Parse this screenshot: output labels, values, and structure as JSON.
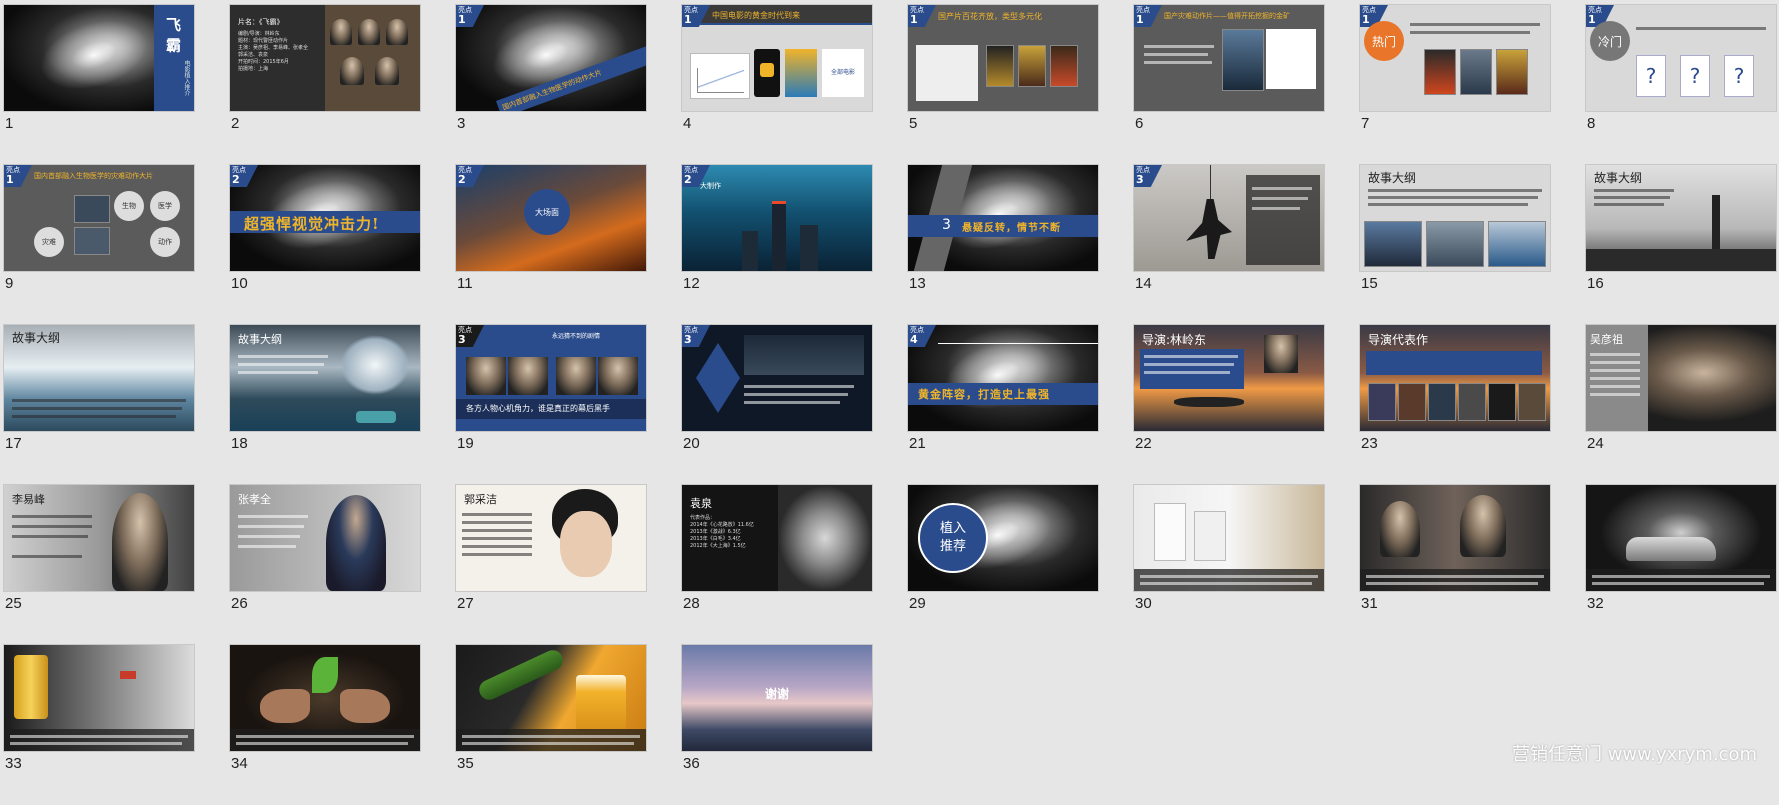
{
  "slides": [
    {
      "num": "1",
      "title": "飞  霸",
      "subtitle": "电影植入推介"
    },
    {
      "num": "2",
      "title": "片名：《飞霸》",
      "info": "编剧/导演：林岭东\n题材：现代警匪动作片\n主演：吴彦祖、李易峰、张孝全\n郭采洁、袁泉\n开拍时间：2015年6月\n拍摄地：上海"
    },
    {
      "num": "3",
      "badge": "亮点",
      "badge_num": "1",
      "slogan": "国内首部融入生物医学的动作大片"
    },
    {
      "num": "4",
      "badge": "亮点",
      "badge_num": "1",
      "title": "中国电影的黄金时代到来",
      "label": "全部电影"
    },
    {
      "num": "5",
      "badge": "亮点",
      "badge_num": "1",
      "title": "国产片百花齐放，类型多元化"
    },
    {
      "num": "6",
      "badge": "亮点",
      "badge_num": "1",
      "title": "国产灾难动作片——值得开拓挖掘的金矿"
    },
    {
      "num": "7",
      "badge": "亮点",
      "badge_num": "1",
      "tag": "热门"
    },
    {
      "num": "8",
      "badge": "亮点",
      "badge_num": "1",
      "tag": "冷门",
      "q": "?"
    },
    {
      "num": "9",
      "badge": "亮点",
      "badge_num": "1",
      "title": "国内首部融入生物医学的灾难动作大片",
      "c1": "生物",
      "c2": "医学",
      "c3": "灾难",
      "c4": "动作"
    },
    {
      "num": "10",
      "badge": "亮点",
      "badge_num": "2",
      "slogan": "超强悍视觉冲击力!"
    },
    {
      "num": "11",
      "badge": "亮点",
      "badge_num": "2",
      "label": "大场面"
    },
    {
      "num": "12",
      "badge": "亮点",
      "badge_num": "2",
      "label": "大制作"
    },
    {
      "num": "13",
      "badge_num": "3",
      "slogan": "悬疑反转，情节不断"
    },
    {
      "num": "14",
      "badge": "亮点",
      "badge_num": "3"
    },
    {
      "num": "15",
      "title": "故事大纲"
    },
    {
      "num": "16",
      "title": "故事大纲"
    },
    {
      "num": "17",
      "title": "故事大纲"
    },
    {
      "num": "18",
      "title": "故事大纲"
    },
    {
      "num": "19",
      "badge": "亮点",
      "badge_num": "3",
      "title": "永远猜不到的剧情",
      "caption": "各方人物心机角力，谁是真正的幕后黑手"
    },
    {
      "num": "20",
      "badge": "亮点",
      "badge_num": "3"
    },
    {
      "num": "21",
      "badge": "亮点",
      "badge_num": "4",
      "slogan": "黄金阵容，打造史上最强"
    },
    {
      "num": "22",
      "title": "导演:林岭东"
    },
    {
      "num": "23",
      "title": "导演代表作"
    },
    {
      "num": "24",
      "title": "吴彦祖"
    },
    {
      "num": "25",
      "title": "李易峰"
    },
    {
      "num": "26",
      "title": "张孝全"
    },
    {
      "num": "27",
      "title": "郭采洁"
    },
    {
      "num": "28",
      "title": "袁泉",
      "info": "代表作品：\n2014年《心花路放》11.6亿\n2013年《激战》6.3亿\n2013年《白毛》3.4亿\n2012年《大上海》1.5亿"
    },
    {
      "num": "29",
      "label": "植入\n推荐"
    },
    {
      "num": "30"
    },
    {
      "num": "31"
    },
    {
      "num": "32"
    },
    {
      "num": "33"
    },
    {
      "num": "34"
    },
    {
      "num": "35"
    },
    {
      "num": "36",
      "title": "谢谢"
    }
  ],
  "watermark": "营销任意门 www.yxrym.com"
}
